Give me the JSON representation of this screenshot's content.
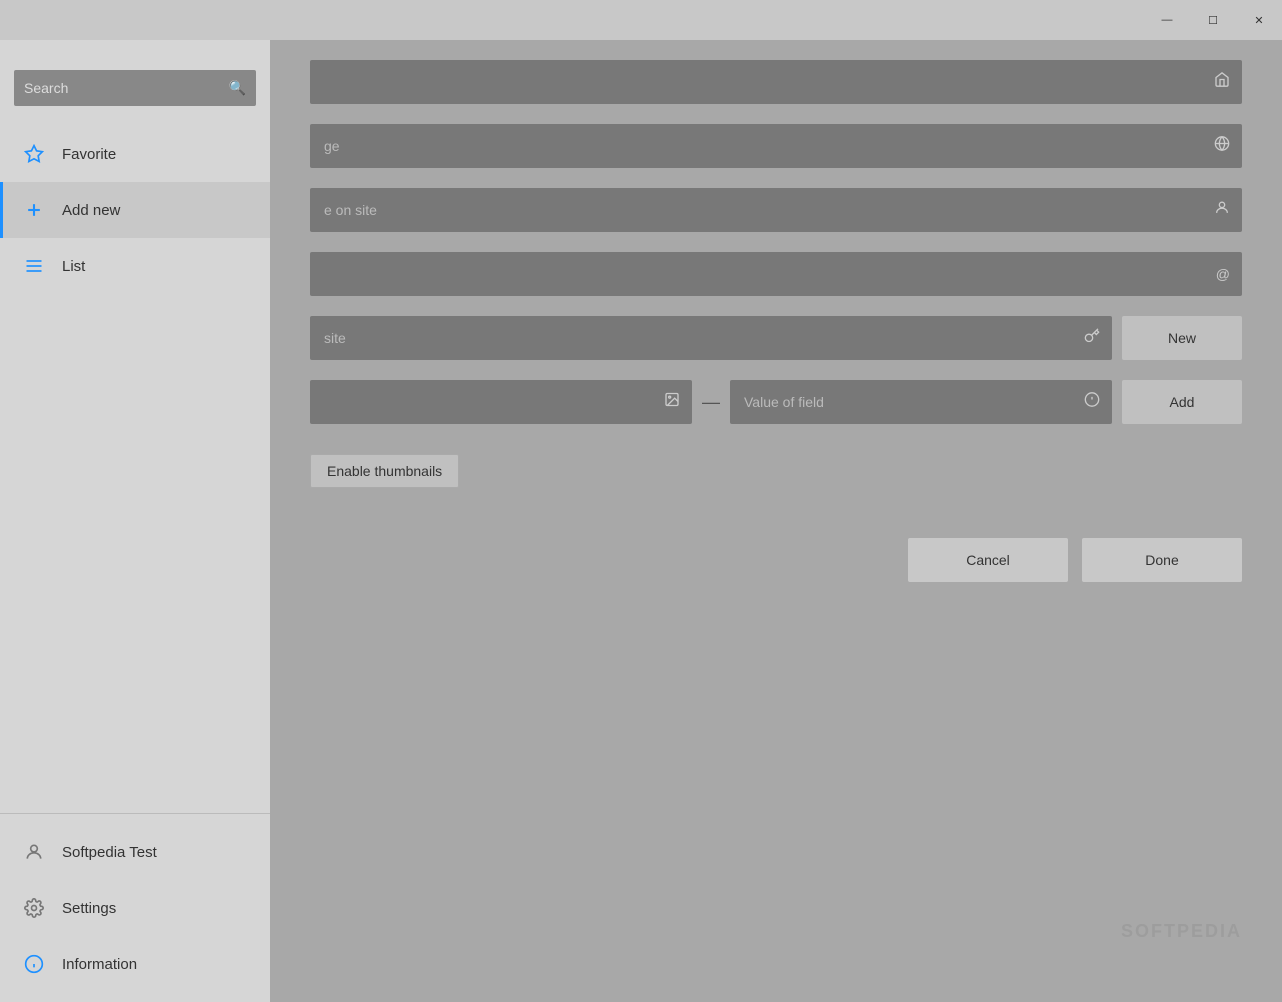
{
  "window": {
    "minimize_label": "—",
    "maximize_label": "☐",
    "close_label": "✕"
  },
  "sidebar": {
    "close_label": "✕",
    "search": {
      "placeholder": "Search",
      "value": ""
    },
    "items": [
      {
        "id": "favorite",
        "label": "Favorite",
        "icon": "★"
      },
      {
        "id": "add-new",
        "label": "Add new",
        "icon": "+"
      },
      {
        "id": "list",
        "label": "List",
        "icon": "☰"
      }
    ],
    "bottom_items": [
      {
        "id": "user",
        "label": "Softpedia Test",
        "icon": "👤"
      },
      {
        "id": "settings",
        "label": "Settings",
        "icon": "⚙"
      },
      {
        "id": "information",
        "label": "Information",
        "icon": "ℹ"
      }
    ]
  },
  "form": {
    "field1": {
      "placeholder": "",
      "value": "",
      "icon": "🏠"
    },
    "field2": {
      "placeholder": "ge",
      "value": "",
      "icon": "🌐"
    },
    "field3": {
      "placeholder": "e on site",
      "value": "",
      "icon": "👤"
    },
    "field4": {
      "placeholder": "",
      "value": "",
      "icon": "@"
    },
    "password_field": {
      "placeholder": "site",
      "value": "",
      "icon": "🔑"
    },
    "new_button": "New",
    "custom_field_left": {
      "placeholder": "",
      "value": "",
      "icon": "🖼"
    },
    "custom_field_right": {
      "placeholder": "Value of field",
      "value": "",
      "icon": "💬"
    },
    "add_button": "Add",
    "enable_thumbnails": "Enable thumbnails",
    "cancel_button": "Cancel",
    "done_button": "Done"
  },
  "watermark": "SOFTPEDIA"
}
